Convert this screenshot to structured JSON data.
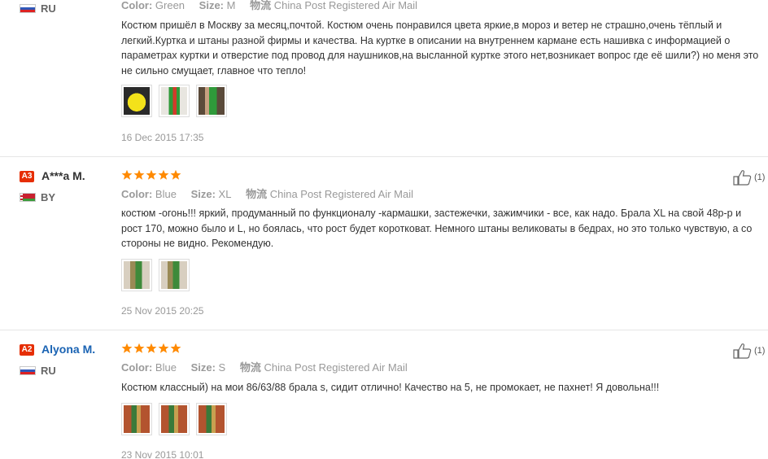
{
  "colors": {
    "star": "#ff8a00",
    "badge": "#e62e04",
    "link": "#1a63b3"
  },
  "labels": {
    "color": "Color:",
    "size": "Size:",
    "shipping": "物流"
  },
  "reviews": [
    {
      "country": "RU",
      "flag": "ru",
      "color": "Green",
      "size": "M",
      "shipping": "China Post Registered Air Mail",
      "text": "Костюм пришёл в Москву за месяц,почтой. Костюм очень понравился цвета яркие,в мороз и ветер не страшно,очень тёплый и легкий.Куртка и штаны разной фирмы и качества. На куртке в описании на внутреннем кармане есть нашивка с информацией о параметрах куртки и отверстие под провод для наушников,на высланной куртке этого нет,возникает вопрос где её шили?) но меня это не сильно смущает, главное что тепло!",
      "date": "16 Dec 2015 17:35",
      "thumbs": [
        "yellow-skirt-photo",
        "green-pants-photo",
        "jacket-photo"
      ]
    },
    {
      "badge": "A3",
      "name": "A***a M.",
      "country": "BY",
      "flag": "by",
      "stars": 5,
      "color": "Blue",
      "size": "XL",
      "shipping": "China Post Registered Air Mail",
      "text": "костюм -огонь!!! яркий, продуманный по функционалу -кармашки, застежечки, зажимчики - все, как надо. Брала XL на свой 48р-р и рост 170, можно было и L, но боялась, что рост будет коротковат. Немного штаны великоваты в бедрах, но это только чувствую, а со стороны не видно. Рекомендую.",
      "date": "25 Nov 2015 20:25",
      "helpful_count": "(1)",
      "thumbs": [
        "suit-photo-1",
        "suit-photo-2"
      ]
    },
    {
      "badge": "A2",
      "name": "Alyona M.",
      "country": "RU",
      "flag": "ru",
      "stars": 5,
      "color": "Blue",
      "size": "S",
      "shipping": "China Post Registered Air Mail",
      "text": "Костюм классный) на мои 86/63/88 брала s, сидит отлично! Качество на 5, не промокает, не пахнет! Я довольна!!!",
      "date": "23 Nov 2015 10:01",
      "helpful_count": "(1)",
      "thumbs": [
        "suit-photo-3",
        "suit-photo-4",
        "suit-photo-5"
      ]
    }
  ]
}
